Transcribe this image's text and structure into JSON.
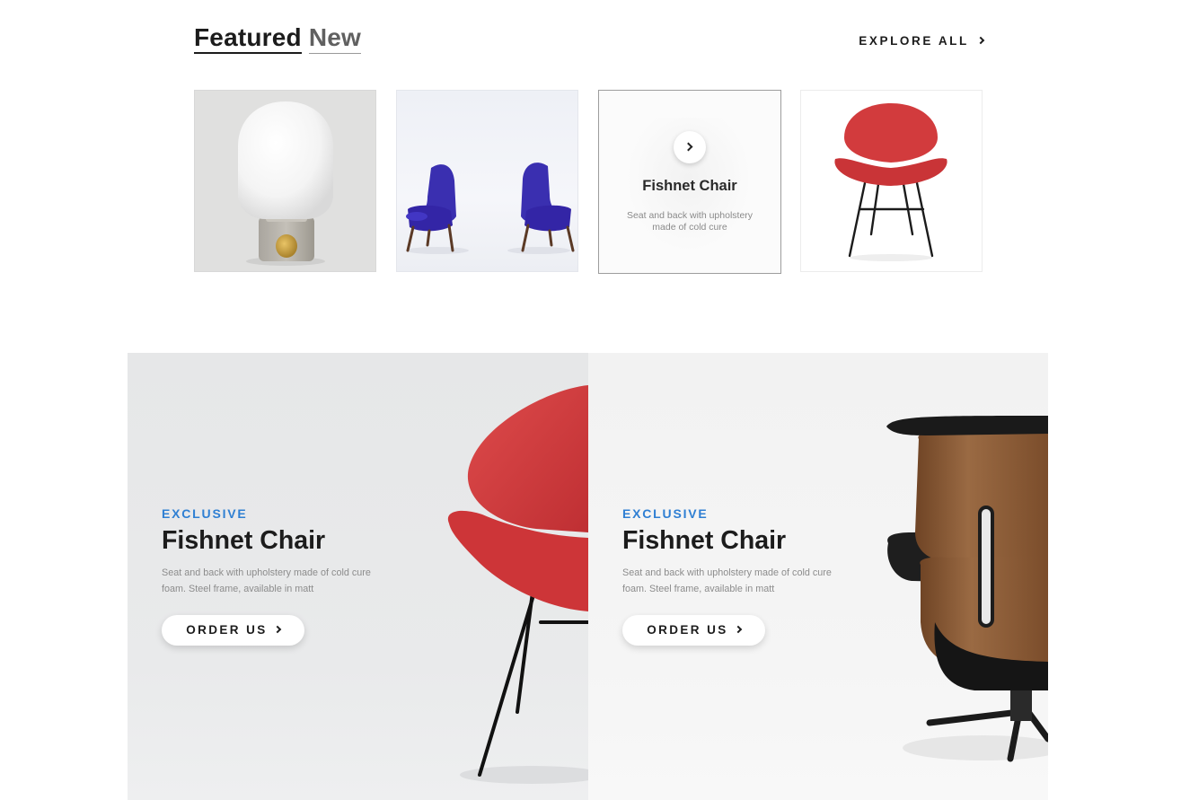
{
  "featured": {
    "heading_part1": "Featured",
    "heading_part2": "New",
    "explore_label": "EXPLORE ALL",
    "tiles": [
      {
        "name": "lamp"
      },
      {
        "name": "blue-armchairs"
      },
      {
        "name": "Fishnet Chair",
        "title": "Fishnet Chair",
        "description": "Seat and back with upholstery made of cold cure"
      },
      {
        "name": "red-chair"
      }
    ]
  },
  "banners": [
    {
      "eyebrow": "EXCLUSIVE",
      "title": "Fishnet Chair",
      "description": "Seat and back with upholstery made of cold cure foam. Steel frame, available in matt",
      "button_label": "ORDER US"
    },
    {
      "eyebrow": "EXCLUSIVE",
      "title": "Fishnet Chair",
      "description": "Seat and back with upholstery made of cold cure foam. Steel frame, available in matt",
      "button_label": "ORDER US"
    }
  ],
  "colors": {
    "accent": "#2f7fd3",
    "chair_red": "#d23b3d",
    "chair_blue": "#3a2fb0",
    "walnut": "#8a5a34"
  },
  "icons": [
    "chevron-right-icon"
  ]
}
